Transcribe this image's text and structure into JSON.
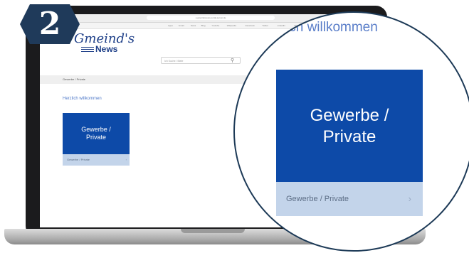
{
  "step": {
    "number": "2"
  },
  "browser": {
    "url": "a gmeindsnews.portal-server.de",
    "bookmarks": [
      "Apps",
      "Gmail",
      "News",
      "Blog",
      "Youtube",
      "Wikipedia",
      "Facebook",
      "Twitter",
      "LinkedIn",
      "Online Shop",
      "Bay"
    ]
  },
  "site": {
    "logo_top": "Gmeind's",
    "logo_bottom": "News",
    "search_placeholder": "Ich Suche / Biete",
    "breadcrumb": "Gewerbe / Private",
    "welcome": "Herzlich willkommen"
  },
  "tile": {
    "title_line1": "Gewerbe /",
    "title_line2": "Private",
    "footer_label": "Gewerbe / Private",
    "arrow": "›"
  },
  "magnifier": {
    "welcome_partial": "ich willkommen"
  }
}
